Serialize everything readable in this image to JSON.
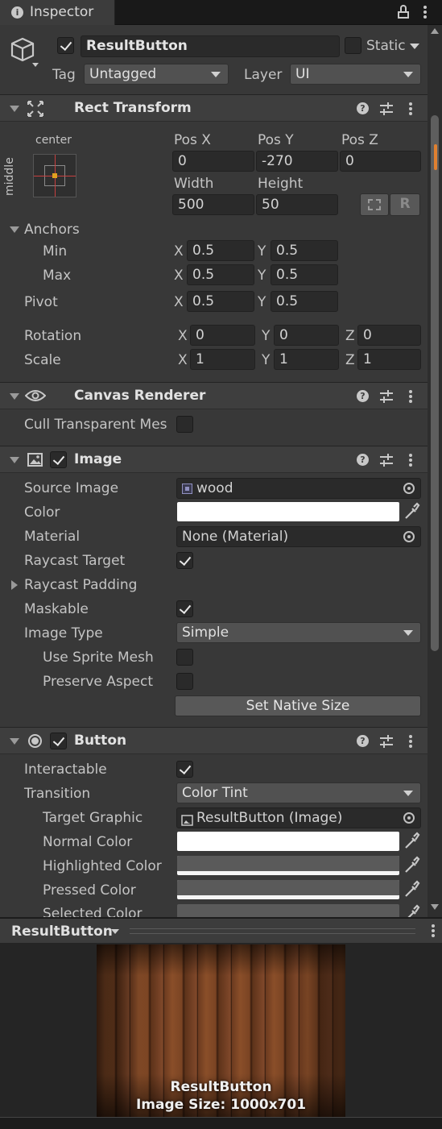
{
  "header": {
    "tab_label": "Inspector",
    "object_name": "ResultButton",
    "static_label": "Static",
    "tag_label": "Tag",
    "tag_value": "Untagged",
    "layer_label": "Layer",
    "layer_value": "UI"
  },
  "rect_transform": {
    "title": "Rect Transform",
    "anchor_h": "center",
    "anchor_v": "middle",
    "pos_x_label": "Pos X",
    "pos_y_label": "Pos Y",
    "pos_z_label": "Pos Z",
    "pos_x": "0",
    "pos_y": "-270",
    "pos_z": "0",
    "width_label": "Width",
    "height_label": "Height",
    "width": "500",
    "height": "50",
    "r_button": "R",
    "anchors_label": "Anchors",
    "min_label": "Min",
    "max_label": "Max",
    "min_x": "0.5",
    "min_y": "0.5",
    "max_x": "0.5",
    "max_y": "0.5",
    "pivot_label": "Pivot",
    "pivot_x": "0.5",
    "pivot_y": "0.5",
    "rotation_label": "Rotation",
    "rot_x": "0",
    "rot_y": "0",
    "rot_z": "0",
    "scale_label": "Scale",
    "scale_x": "1",
    "scale_y": "1",
    "scale_z": "1",
    "x": "X",
    "y": "Y",
    "z": "Z"
  },
  "canvas_renderer": {
    "title": "Canvas Renderer",
    "cull_label": "Cull Transparent Mes"
  },
  "image": {
    "title": "Image",
    "source_label": "Source Image",
    "source_value": "wood",
    "color_label": "Color",
    "color_value": "#ffffff",
    "material_label": "Material",
    "material_value": "None (Material)",
    "raycast_target_label": "Raycast Target",
    "raycast_padding_label": "Raycast Padding",
    "maskable_label": "Maskable",
    "image_type_label": "Image Type",
    "image_type_value": "Simple",
    "use_sprite_mesh_label": "Use Sprite Mesh",
    "preserve_aspect_label": "Preserve Aspect",
    "set_native_size": "Set Native Size"
  },
  "button": {
    "title": "Button",
    "interactable_label": "Interactable",
    "transition_label": "Transition",
    "transition_value": "Color Tint",
    "target_graphic_label": "Target Graphic",
    "target_graphic_value": "ResultButton (Image)",
    "normal_color_label": "Normal Color",
    "highlighted_color_label": "Highlighted Color",
    "pressed_color_label": "Pressed Color",
    "selected_color_label": "Selected Color"
  },
  "preview": {
    "title": "ResultButton",
    "caption_name": "ResultButton",
    "caption_size": "Image Size: 1000x701"
  }
}
